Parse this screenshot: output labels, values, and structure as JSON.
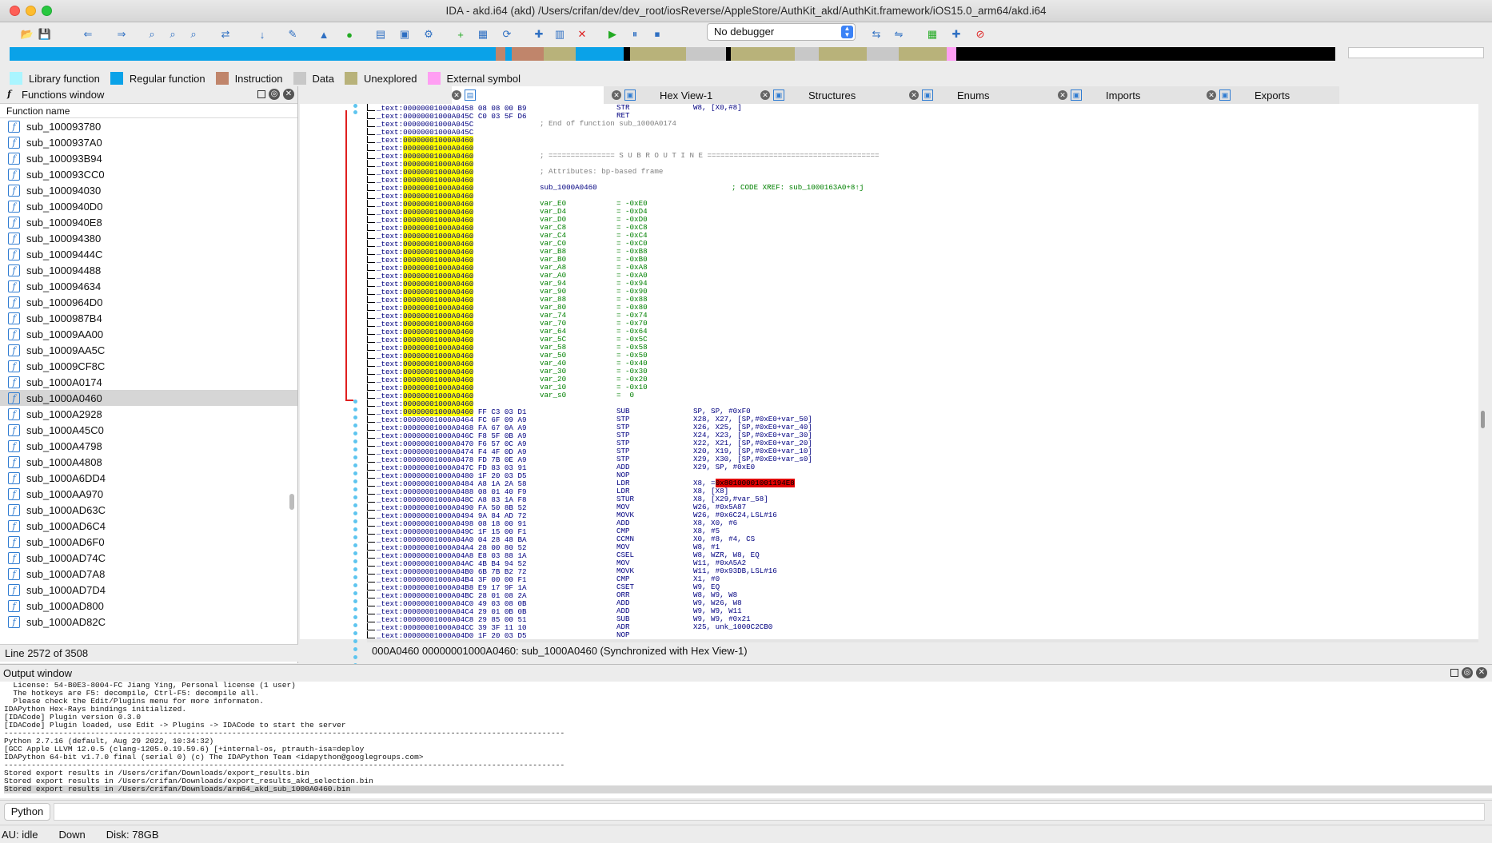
{
  "window": {
    "title": "IDA - akd.i64 (akd) /Users/crifan/dev/dev_root/iosReverse/AppleStore/AuthKit_akd/AuthKit.framework/iOS15.0_arm64/akd.i64"
  },
  "toolbar": {
    "debugger_select": "No debugger",
    "icons": [
      "open-icon",
      "save-icon",
      "back-icon",
      "forward-icon",
      "binary-search-icon",
      "text-search-icon",
      "immediate-search-icon",
      "xref-icon",
      "jump-icon",
      "mark-icon",
      "graph-icon",
      "run-icon",
      "structures-icon",
      "enums-icon",
      "debug-icon",
      "add-icon",
      "list-icon",
      "refresh-icon",
      "pointer-icon",
      "chart-icon",
      "stop-icon",
      "play-icon",
      "pause-icon",
      "terminate-icon",
      "attach-icon",
      "detach-icon",
      "breakpoint-icon",
      "trace-icon",
      "clear-icon"
    ]
  },
  "legend": [
    {
      "label": "Library function",
      "color": "#aaf5ff"
    },
    {
      "label": "Regular function",
      "color": "#0aa2e8"
    },
    {
      "label": "Instruction",
      "color": "#c0856b"
    },
    {
      "label": "Data",
      "color": "#c8c8c8"
    },
    {
      "label": "Unexplored",
      "color": "#b8b27a"
    },
    {
      "label": "External symbol",
      "color": "#ff9ef3"
    }
  ],
  "functions_window": {
    "title": "Functions window",
    "column_header": "Function name",
    "items": [
      "sub_100093780",
      "sub_1000937A0",
      "sub_100093B94",
      "sub_100093CC0",
      "sub_100094030",
      "sub_1000940D0",
      "sub_1000940E8",
      "sub_100094380",
      "sub_10009444C",
      "sub_100094488",
      "sub_100094634",
      "sub_1000964D0",
      "sub_1000987B4",
      "sub_10009AA00",
      "sub_10009AA5C",
      "sub_10009CF8C",
      "sub_1000A0174",
      "sub_1000A0460",
      "sub_1000A2928",
      "sub_1000A45C0",
      "sub_1000A4798",
      "sub_1000A4808",
      "sub_1000A6DD4",
      "sub_1000AA970",
      "sub_1000AD63C",
      "sub_1000AD6C4",
      "sub_1000AD6F0",
      "sub_1000AD74C",
      "sub_1000AD7A8",
      "sub_1000AD7D4",
      "sub_1000AD800",
      "sub_1000AD82C"
    ],
    "selected_index": 17,
    "status": "Line 2572 of 3508"
  },
  "tabs": [
    {
      "label": "",
      "icon": "ida-view-icon"
    },
    {
      "label": "",
      "icon": "pseudocode-icon"
    },
    {
      "label": "Hex View-1",
      "icon": "hex-icon"
    },
    {
      "label": "Structures",
      "icon": "structures-icon"
    },
    {
      "label": "Enums",
      "icon": "enums-icon"
    },
    {
      "label": "Imports",
      "icon": "imports-icon"
    },
    {
      "label": "Exports",
      "icon": "exports-icon"
    }
  ],
  "disasm": {
    "status": "000A0460  00000001000A0460: sub_1000A0460  (Synchronized with Hex View-1)",
    "lines": [
      {
        "seg": "_text:",
        "addr": "00000001000A0458",
        "bytes": "08 08 00 B9",
        "mn": "STR",
        "op": "W8, [X0,#8]"
      },
      {
        "seg": "_text:",
        "addr": "00000001000A045C",
        "bytes": "C0 03 5F D6",
        "mn": "RET",
        "op": ""
      },
      {
        "seg": "_text:",
        "addr": "00000001000A045C",
        "cmt": "; End of function sub_1000A0174"
      },
      {
        "seg": "_text:",
        "addr": "00000001000A045C"
      },
      {
        "seg": "_text:",
        "addr": "00000001000A0460",
        "hl": true
      },
      {
        "seg": "_text:",
        "addr": "00000001000A0460",
        "hl": true
      },
      {
        "seg": "_text:",
        "addr": "00000001000A0460",
        "hl": true,
        "cmt": "; =============== S U B R O U T I N E ======================================="
      },
      {
        "seg": "_text:",
        "addr": "00000001000A0460",
        "hl": true
      },
      {
        "seg": "_text:",
        "addr": "00000001000A0460",
        "hl": true,
        "cmt": "; Attributes: bp-based frame"
      },
      {
        "seg": "_text:",
        "addr": "00000001000A0460",
        "hl": true
      },
      {
        "seg": "_text:",
        "addr": "00000001000A0460",
        "hl": true,
        "lbl": "sub_1000A0460",
        "xref": "; CODE XREF: sub_1000163A0+8↑j"
      },
      {
        "seg": "_text:",
        "addr": "00000001000A0460",
        "hl": true
      },
      {
        "seg": "_text:",
        "addr": "00000001000A0460",
        "hl": true,
        "var": "var_E0",
        "eq": "= -0xE0"
      },
      {
        "seg": "_text:",
        "addr": "00000001000A0460",
        "hl": true,
        "var": "var_D4",
        "eq": "= -0xD4"
      },
      {
        "seg": "_text:",
        "addr": "00000001000A0460",
        "hl": true,
        "var": "var_D0",
        "eq": "= -0xD0"
      },
      {
        "seg": "_text:",
        "addr": "00000001000A0460",
        "hl": true,
        "var": "var_C8",
        "eq": "= -0xC8"
      },
      {
        "seg": "_text:",
        "addr": "00000001000A0460",
        "hl": true,
        "var": "var_C4",
        "eq": "= -0xC4"
      },
      {
        "seg": "_text:",
        "addr": "00000001000A0460",
        "hl": true,
        "var": "var_C0",
        "eq": "= -0xC0"
      },
      {
        "seg": "_text:",
        "addr": "00000001000A0460",
        "hl": true,
        "var": "var_B8",
        "eq": "= -0xB8"
      },
      {
        "seg": "_text:",
        "addr": "00000001000A0460",
        "hl": true,
        "var": "var_B0",
        "eq": "= -0xB0"
      },
      {
        "seg": "_text:",
        "addr": "00000001000A0460",
        "hl": true,
        "var": "var_A8",
        "eq": "= -0xA8"
      },
      {
        "seg": "_text:",
        "addr": "00000001000A0460",
        "hl": true,
        "var": "var_A0",
        "eq": "= -0xA0"
      },
      {
        "seg": "_text:",
        "addr": "00000001000A0460",
        "hl": true,
        "var": "var_94",
        "eq": "= -0x94"
      },
      {
        "seg": "_text:",
        "addr": "00000001000A0460",
        "hl": true,
        "var": "var_90",
        "eq": "= -0x90"
      },
      {
        "seg": "_text:",
        "addr": "00000001000A0460",
        "hl": true,
        "var": "var_88",
        "eq": "= -0x88"
      },
      {
        "seg": "_text:",
        "addr": "00000001000A0460",
        "hl": true,
        "var": "var_80",
        "eq": "= -0x80"
      },
      {
        "seg": "_text:",
        "addr": "00000001000A0460",
        "hl": true,
        "var": "var_74",
        "eq": "= -0x74"
      },
      {
        "seg": "_text:",
        "addr": "00000001000A0460",
        "hl": true,
        "var": "var_70",
        "eq": "= -0x70"
      },
      {
        "seg": "_text:",
        "addr": "00000001000A0460",
        "hl": true,
        "var": "var_64",
        "eq": "= -0x64"
      },
      {
        "seg": "_text:",
        "addr": "00000001000A0460",
        "hl": true,
        "var": "var_5C",
        "eq": "= -0x5C"
      },
      {
        "seg": "_text:",
        "addr": "00000001000A0460",
        "hl": true,
        "var": "var_58",
        "eq": "= -0x58"
      },
      {
        "seg": "_text:",
        "addr": "00000001000A0460",
        "hl": true,
        "var": "var_50",
        "eq": "= -0x50"
      },
      {
        "seg": "_text:",
        "addr": "00000001000A0460",
        "hl": true,
        "var": "var_40",
        "eq": "= -0x40"
      },
      {
        "seg": "_text:",
        "addr": "00000001000A0460",
        "hl": true,
        "var": "var_30",
        "eq": "= -0x30"
      },
      {
        "seg": "_text:",
        "addr": "00000001000A0460",
        "hl": true,
        "var": "var_20",
        "eq": "= -0x20"
      },
      {
        "seg": "_text:",
        "addr": "00000001000A0460",
        "hl": true,
        "var": "var_10",
        "eq": "= -0x10"
      },
      {
        "seg": "_text:",
        "addr": "00000001000A0460",
        "hl": true,
        "var": "var_s0",
        "eq": "=  0"
      },
      {
        "seg": "_text:",
        "addr": "00000001000A0460",
        "hl": true
      },
      {
        "seg": "_text:",
        "addr": "00000001000A0460",
        "hl": true,
        "bytes": "FF C3 03 D1",
        "mn": "SUB",
        "op": "SP, SP, #0xF0"
      },
      {
        "seg": "_text:",
        "addr": "00000001000A0464",
        "bytes": "FC 6F 09 A9",
        "mn": "STP",
        "op": "X28, X27, [SP,#0xE0+var_50]"
      },
      {
        "seg": "_text:",
        "addr": "00000001000A0468",
        "bytes": "FA 67 0A A9",
        "mn": "STP",
        "op": "X26, X25, [SP,#0xE0+var_40]"
      },
      {
        "seg": "_text:",
        "addr": "00000001000A046C",
        "bytes": "F8 5F 0B A9",
        "mn": "STP",
        "op": "X24, X23, [SP,#0xE0+var_30]"
      },
      {
        "seg": "_text:",
        "addr": "00000001000A0470",
        "bytes": "F6 57 0C A9",
        "mn": "STP",
        "op": "X22, X21, [SP,#0xE0+var_20]"
      },
      {
        "seg": "_text:",
        "addr": "00000001000A0474",
        "bytes": "F4 4F 0D A9",
        "mn": "STP",
        "op": "X20, X19, [SP,#0xE0+var_10]"
      },
      {
        "seg": "_text:",
        "addr": "00000001000A0478",
        "bytes": "FD 7B 0E A9",
        "mn": "STP",
        "op": "X29, X30, [SP,#0xE0+var_s0]"
      },
      {
        "seg": "_text:",
        "addr": "00000001000A047C",
        "bytes": "FD 83 03 91",
        "mn": "ADD",
        "op": "X29, SP, #0xE0"
      },
      {
        "seg": "_text:",
        "addr": "00000001000A0480",
        "bytes": "1F 20 03 D5",
        "mn": "NOP",
        "op": ""
      },
      {
        "seg": "_text:",
        "addr": "00000001000A0484",
        "bytes": "A8 1A 2A 58",
        "mn": "LDR",
        "op": "X8, =",
        "opred": "0x80100001001194E8"
      },
      {
        "seg": "_text:",
        "addr": "00000001000A0488",
        "bytes": "08 01 40 F9",
        "mn": "LDR",
        "op": "X8, [X8]"
      },
      {
        "seg": "_text:",
        "addr": "00000001000A048C",
        "bytes": "A8 83 1A F8",
        "mn": "STUR",
        "op": "X8, [X29,#var_58]"
      },
      {
        "seg": "_text:",
        "addr": "00000001000A0490",
        "bytes": "FA 50 8B 52",
        "mn": "MOV",
        "op": "W26, #0x5A87"
      },
      {
        "seg": "_text:",
        "addr": "00000001000A0494",
        "bytes": "9A 84 AD 72",
        "mn": "MOVK",
        "op": "W26, #0x6C24,LSL#16"
      },
      {
        "seg": "_text:",
        "addr": "00000001000A0498",
        "bytes": "08 18 00 91",
        "mn": "ADD",
        "op": "X8, X0, #6"
      },
      {
        "seg": "_text:",
        "addr": "00000001000A049C",
        "bytes": "1F 15 00 F1",
        "mn": "CMP",
        "op": "X8, #5"
      },
      {
        "seg": "_text:",
        "addr": "00000001000A04A0",
        "bytes": "04 28 48 BA",
        "mn": "CCMN",
        "op": "X0, #8, #4, CS"
      },
      {
        "seg": "_text:",
        "addr": "00000001000A04A4",
        "bytes": "28 00 80 52",
        "mn": "MOV",
        "op": "W8, #1"
      },
      {
        "seg": "_text:",
        "addr": "00000001000A04A8",
        "bytes": "E8 03 88 1A",
        "mn": "CSEL",
        "op": "W8, WZR, W8, EQ"
      },
      {
        "seg": "_text:",
        "addr": "00000001000A04AC",
        "bytes": "4B B4 94 52",
        "mn": "MOV",
        "op": "W11, #0xA5A2"
      },
      {
        "seg": "_text:",
        "addr": "00000001000A04B0",
        "bytes": "6B 7B B2 72",
        "mn": "MOVK",
        "op": "W11, #0x93DB,LSL#16"
      },
      {
        "seg": "_text:",
        "addr": "00000001000A04B4",
        "bytes": "3F 00 00 F1",
        "mn": "CMP",
        "op": "X1, #0"
      },
      {
        "seg": "_text:",
        "addr": "00000001000A04B8",
        "bytes": "E9 17 9F 1A",
        "mn": "CSET",
        "op": "W9, EQ"
      },
      {
        "seg": "_text:",
        "addr": "00000001000A04BC",
        "bytes": "28 01 08 2A",
        "mn": "ORR",
        "op": "W8, W9, W8"
      },
      {
        "seg": "_text:",
        "addr": "00000001000A04C0",
        "bytes": "49 03 08 0B",
        "mn": "ADD",
        "op": "W9, W26, W8"
      },
      {
        "seg": "_text:",
        "addr": "00000001000A04C4",
        "bytes": "29 01 0B 0B",
        "mn": "ADD",
        "op": "W9, W9, W11"
      },
      {
        "seg": "_text:",
        "addr": "00000001000A04C8",
        "bytes": "29 85 00 51",
        "mn": "SUB",
        "op": "W9, W9, #0x21"
      },
      {
        "seg": "_text:",
        "addr": "00000001000A04CC",
        "bytes": "39 3F 11 10",
        "mn": "ADR",
        "op": "X25, unk_1000C2CB0"
      },
      {
        "seg": "_text:",
        "addr": "00000001000A04D0",
        "bytes": "1F 20 03 D5",
        "mn": "NOP",
        "op": ""
      },
      {
        "seg": "_text:",
        "addr": "00000001000A04D4",
        "bytes": "29 DB A9 B8",
        "mn": "LDRSW",
        "op": "X9, [X25,W9,SXTW#2]"
      }
    ]
  },
  "output_window": {
    "title": "Output window",
    "lines": [
      "  License: 54-B0E3-8004-FC Jiang Ying, Personal license (1 user)",
      "  The hotkeys are F5: decompile, Ctrl-F5: decompile all.",
      "  Please check the Edit/Plugins menu for more informaton.",
      "IDAPython Hex-Rays bindings initialized.",
      "[IDACode] Plugin version 0.3.0",
      "[IDACode] Plugin loaded, use Edit -> Plugins -> IDACode to start the server",
      "---------------------------------------------------------------------------------------------------------------------------",
      "Python 2.7.16 (default, Aug 29 2022, 10:34:32)",
      "[GCC Apple LLVM 12.0.5 (clang-1205.0.19.59.6) [+internal-os, ptrauth-isa=deploy",
      "IDAPython 64-bit v1.7.0 final (serial 0) (c) The IDAPython Team <idapython@googlegroups.com>",
      "---------------------------------------------------------------------------------------------------------------------------",
      "Stored export results in /Users/crifan/Downloads/export_results.bin",
      "Stored export results in /Users/crifan/Downloads/export_results_akd_selection.bin",
      "Stored export results in /Users/crifan/Downloads/arm64_akd_sub_1000A0460.bin"
    ],
    "selected_index": 13
  },
  "python_bar": {
    "label": "Python"
  },
  "statusbar": {
    "au": "AU:  idle",
    "direction": "Down",
    "disk": "Disk: 78GB"
  }
}
